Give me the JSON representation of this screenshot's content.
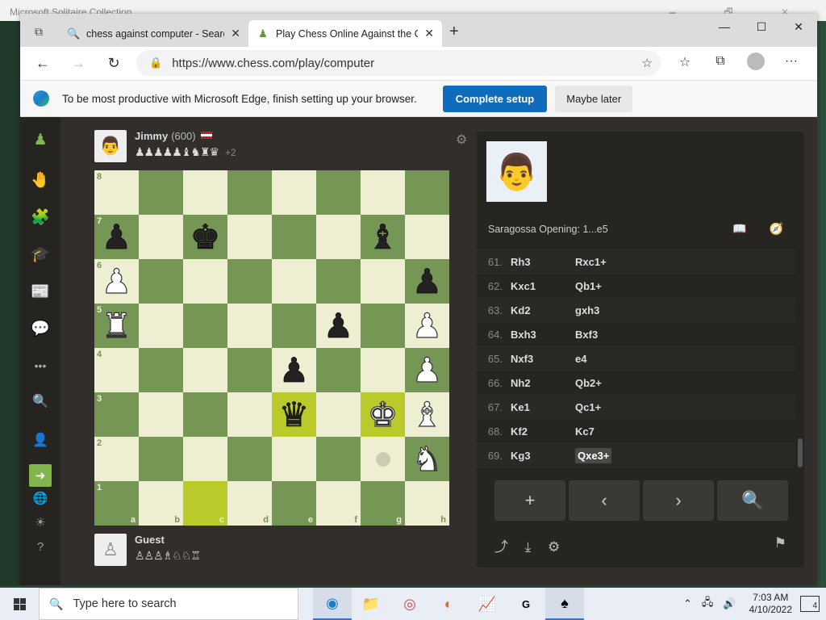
{
  "background": {
    "title": "Microsoft Solitaire Collection",
    "window_controls": "🗕 🗗 ✕"
  },
  "browser": {
    "tabs": [
      {
        "title": "chess against computer - Search",
        "close": "✕",
        "favicon": "🔍"
      },
      {
        "title": "Play Chess Online Against the Co",
        "close": "✕",
        "favicon": "♟"
      }
    ],
    "tab_actions_icon": "⧉",
    "new_tab": "+",
    "window_controls": {
      "minimize": "—",
      "maximize": "☐",
      "close": "✕"
    },
    "nav": {
      "back": "←",
      "forward": "→",
      "refresh": "↻"
    },
    "url": "https://www.chess.com/play/computer",
    "lock_icon": "🔒",
    "add_favorite_icon": "☆",
    "toolbar": {
      "favorites": "☆",
      "collections": "⧉",
      "menu": "···"
    }
  },
  "infobar": {
    "message": "To be most productive with Microsoft Edge, finish setting up your browser.",
    "primary": "Complete setup",
    "secondary": "Maybe later"
  },
  "sidebar": [
    "♟",
    "🤚",
    "🧩",
    "🎓",
    "📰",
    "💬",
    "•••",
    "🔍",
    "👤",
    "➜",
    "🌐",
    "☀",
    "?"
  ],
  "top_player": {
    "name": "Jimmy",
    "rating": "(600)",
    "captured": "♟♟♟♟♟♝♞♜♛",
    "advantage": "+2",
    "avatar": "👨"
  },
  "bottom_player": {
    "name": "Guest",
    "captured": "♙♙♙♗♘♘♖",
    "avatar": "♙"
  },
  "settings_icon": "⚙",
  "board": {
    "ranks": [
      "8",
      "7",
      "6",
      "5",
      "4",
      "3",
      "2",
      "1"
    ],
    "files": [
      "a",
      "b",
      "c",
      "d",
      "e",
      "f",
      "g",
      "h"
    ],
    "rows": [
      [
        "",
        "",
        "",
        "",
        "",
        "",
        "",
        ""
      ],
      [
        "bp",
        "",
        "bk",
        "",
        "",
        "",
        "bb",
        ""
      ],
      [
        "wp",
        "",
        "",
        "",
        "",
        "",
        "",
        "bp"
      ],
      [
        "wr",
        "",
        "",
        "",
        "",
        "bp",
        "",
        "wp"
      ],
      [
        "",
        "",
        "",
        "",
        "bp",
        "",
        "",
        "wp"
      ],
      [
        "",
        "",
        "",
        "",
        "bq",
        "",
        "wk",
        "wb"
      ],
      [
        "",
        "",
        "",
        "",
        "",
        "",
        "",
        "wn"
      ],
      [
        "",
        "",
        "",
        "",
        "",
        "",
        "",
        ""
      ]
    ],
    "highlighted": [
      "e3",
      "g3",
      "c1"
    ],
    "move_hint": [
      "g2"
    ]
  },
  "right_panel": {
    "avatar": "👨",
    "opening": "Saragossa Opening: 1...e5",
    "opening_icons": "📖 🧭",
    "moves": [
      {
        "n": "61.",
        "w": "Rh3",
        "b": "Rxc1+"
      },
      {
        "n": "62.",
        "w": "Kxc1",
        "b": "Qb1+"
      },
      {
        "n": "63.",
        "w": "Kd2",
        "b": "gxh3"
      },
      {
        "n": "64.",
        "w": "Bxh3",
        "b": "Bxf3"
      },
      {
        "n": "65.",
        "w": "Nxf3",
        "b": "e4"
      },
      {
        "n": "66.",
        "w": "Nh2",
        "b": "Qb2+"
      },
      {
        "n": "67.",
        "w": "Ke1",
        "b": "Qc1+"
      },
      {
        "n": "68.",
        "w": "Kf2",
        "b": "Kc7"
      },
      {
        "n": "69.",
        "w": "Kg3",
        "b": "Qxe3+"
      }
    ],
    "controls": {
      "add": "+",
      "prev": "‹",
      "next": "›",
      "analyze": "🔍"
    },
    "actions": {
      "share": "⤴",
      "download": "⤓",
      "settings": "⚙",
      "resign": "⚑"
    }
  },
  "taskbar": {
    "search_placeholder": "Type here to search",
    "apps": [
      "◉",
      "📁",
      "◎",
      "◐",
      "📈",
      "G",
      "♠"
    ],
    "time": "7:03 AM",
    "date": "4/10/2022",
    "tray_icons": [
      "⌃",
      "🖧",
      "🔊"
    ],
    "notifications": "4"
  }
}
